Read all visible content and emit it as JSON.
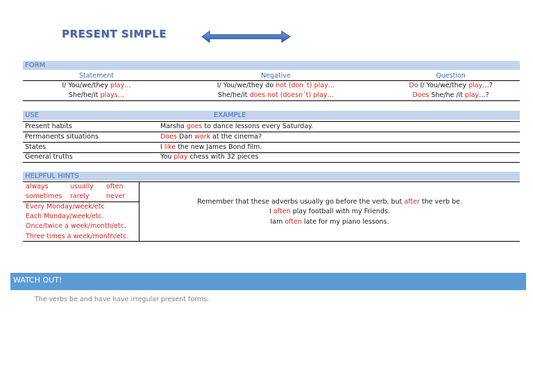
{
  "title": "PRESENT SIMPLE",
  "form": {
    "header": "FORM",
    "columns": [
      "Statement",
      "Negative",
      "Question"
    ],
    "rows": [
      {
        "statement": {
          "pre": "I/ You/we/they ",
          "red": "play…",
          "post": ""
        },
        "negative": {
          "pre": "I/ You/we/they do ",
          "red": "not (don´t) play…",
          "post": ""
        },
        "question": {
          "red1": "Do",
          "mid": " I/ You/we/they ",
          "red2": "play",
          "post": "…?"
        }
      },
      {
        "statement": {
          "pre": "She/he/it ",
          "red": "plays…",
          "post": ""
        },
        "negative": {
          "pre": "She/he/it ",
          "red": "does not (doesn´t) play…",
          "post": ""
        },
        "question": {
          "red1": "Does",
          "mid": " She/he /it ",
          "red2": "play",
          "post": "…?"
        }
      }
    ]
  },
  "use": {
    "header": "USE",
    "example_header": "EXAMPLE",
    "rows": [
      {
        "use": "Present habits",
        "ex": [
          {
            "t": "Marsha "
          },
          {
            "t": "goes",
            "red": true
          },
          {
            "t": " to dance lessons every Saturday."
          }
        ]
      },
      {
        "use": "Permanents situations",
        "ex": [
          {
            "t": "Does",
            "red": true
          },
          {
            "t": " Dan "
          },
          {
            "t": "work",
            "red": true
          },
          {
            "t": " at the cinema?"
          }
        ]
      },
      {
        "use": "States",
        "ex": [
          {
            "t": "I "
          },
          {
            "t": "like",
            "red": true
          },
          {
            "t": " the new James Bond film."
          }
        ]
      },
      {
        "use": "General truths",
        "ex": [
          {
            "t": "You "
          },
          {
            "t": "play",
            "red": true
          },
          {
            "t": " chess with 32 pieces"
          }
        ]
      }
    ]
  },
  "hints": {
    "header": "HELPFUL HINTS",
    "adverbs_row1": [
      "always",
      "usually",
      "often"
    ],
    "adverbs_row2": [
      "sometimes",
      "rarely",
      "never"
    ],
    "time_expressions": [
      "Every Monday/week/etc",
      "Each Monday/week/etc.",
      "Once/twice a week/month/etc.",
      "Three times a week/month/etc."
    ],
    "note_line1": {
      "pre": "Remember that these adverbs usually go before the verb, but ",
      "red": "after",
      "post": " the verb be."
    },
    "note_line2": {
      "pre": "I ",
      "red": "often",
      "post": " play football with my Friends."
    },
    "note_line3": {
      "pre": "Iam ",
      "red": "often",
      "post": " late for my piano lessons."
    }
  },
  "watch_out": {
    "header": "WATCH OUT!",
    "text": "The verbs be and have have irregular present forms."
  },
  "colors": {
    "accent": "#3d6fb6",
    "highlight": "#e0231a",
    "bar": "#c5d3ec",
    "watch": "#5b9bd5"
  }
}
